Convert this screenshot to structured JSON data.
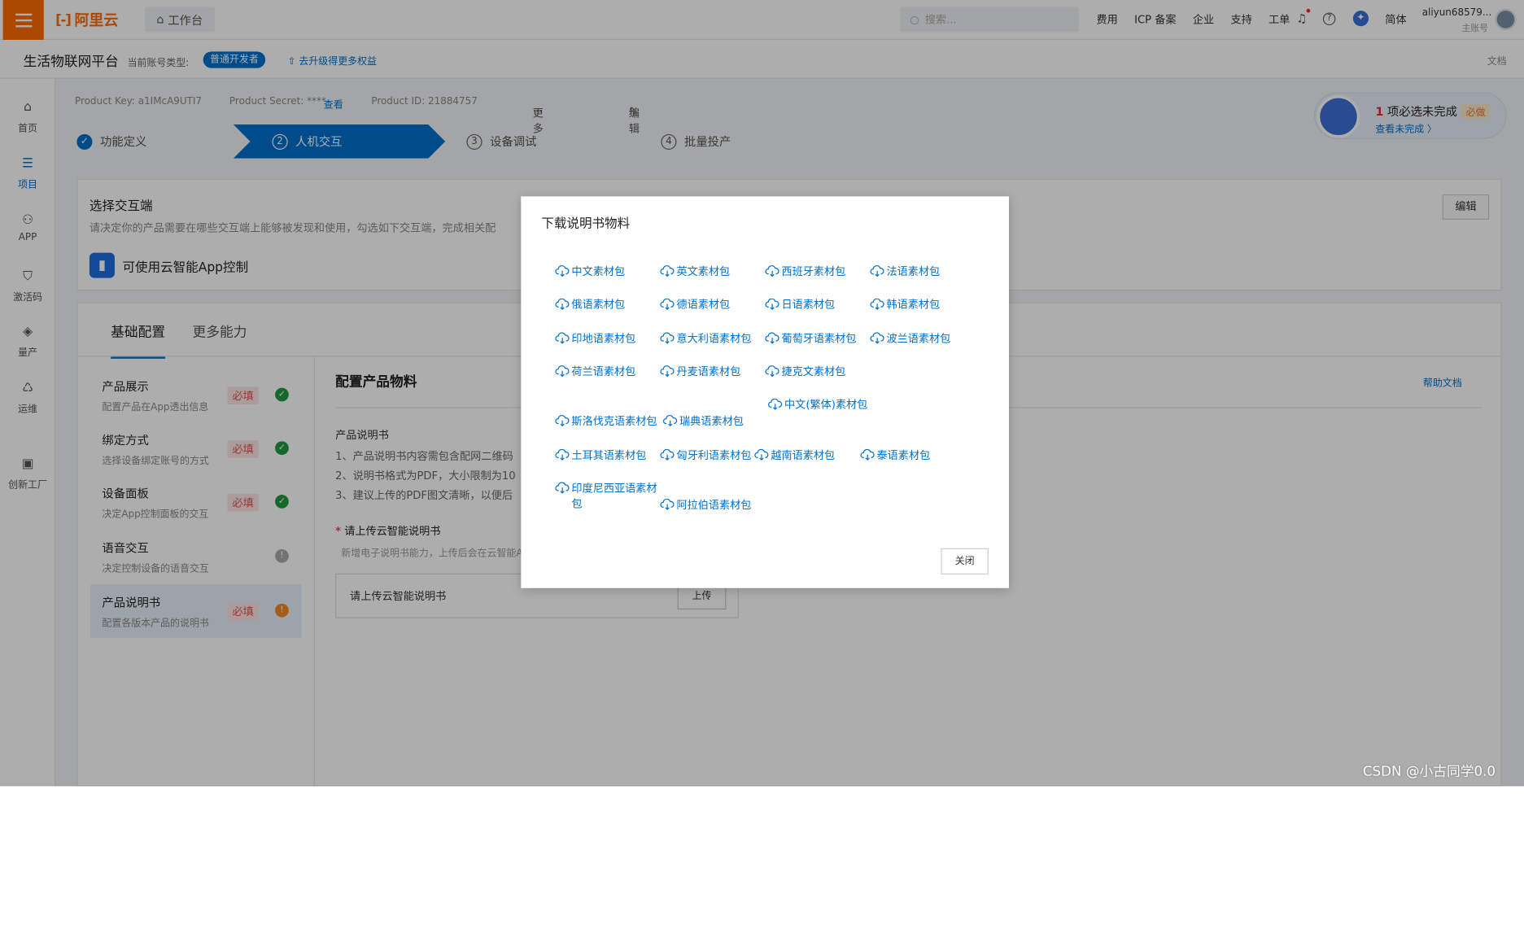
{
  "topbar": {
    "logo": "阿里云",
    "workbench": "工作台",
    "search_placeholder": "搜索...",
    "nav": [
      "费用",
      "ICP 备案",
      "企业",
      "支持",
      "工单"
    ],
    "lang": "简体",
    "username": "aliyun68579...",
    "user_role": "主账号",
    "accent": "#ff6a00"
  },
  "subbar": {
    "platform": "生活物联网平台",
    "account_type_label": "当前账号类型:",
    "account_badge": "普通开发者",
    "upgrade": "去升级得更多权益",
    "docs": "文档"
  },
  "sidebar": {
    "items": [
      {
        "label": "首页",
        "icon": "home-icon"
      },
      {
        "label": "项目",
        "icon": "list-icon"
      },
      {
        "label": "APP",
        "icon": "app-icon"
      },
      {
        "label": "激活码",
        "icon": "shield-icon"
      },
      {
        "label": "量产",
        "icon": "layers-icon"
      },
      {
        "label": "运维",
        "icon": "recycle-icon"
      },
      {
        "label": "创新工厂",
        "icon": "factory-icon"
      }
    ],
    "active_index": 1
  },
  "infobar": {
    "product_key": "Product Key:  a1IMcA9UTI7",
    "product_secret": "Product Secret: ****",
    "view": "查看",
    "product_id": "Product ID:  21884757",
    "more": "更多",
    "edit": "编辑"
  },
  "steps": [
    {
      "num": "✓",
      "label": "功能定义",
      "state": "done"
    },
    {
      "num": "2",
      "label": "人机交互",
      "state": "current"
    },
    {
      "num": "3",
      "label": "设备调试",
      "state": "todo"
    },
    {
      "num": "4",
      "label": "批量投产",
      "state": "todo"
    }
  ],
  "tip": {
    "count": "1",
    "text": " 项必选未完成",
    "required": "必做",
    "link": "查看未完成 〉"
  },
  "interaction": {
    "title": "选择交互端",
    "desc": "请决定你的产品需要在哪些交互端上能够被发现和使用，勾选如下交互端，完成相关配",
    "app": "可使用云智能App控制",
    "edit_button": "编辑"
  },
  "config": {
    "tabs": [
      "基础配置",
      "更多能力"
    ],
    "items": [
      {
        "name": "产品展示",
        "sub": "配置产品在App透出信息",
        "required": "必填",
        "status": "✓"
      },
      {
        "name": "绑定方式",
        "sub": "选择设备绑定账号的方式",
        "required": "必填",
        "status": "✓"
      },
      {
        "name": "设备面板",
        "sub": "决定App控制面板的交互",
        "required": "必填",
        "status": "✓"
      },
      {
        "name": "语音交互",
        "sub": "决定控制设备的语音交互",
        "required": "",
        "status": "!"
      },
      {
        "name": "产品说明书",
        "sub": "配置各版本产品的说明书",
        "required": "必填",
        "status": "!"
      }
    ],
    "right_title": "配置产品物料",
    "help": "帮助文档",
    "manual_title": "产品说明书",
    "manual_lines": [
      "1、产品说明书内容需包含配网二维码",
      "2、说明书格式为PDF，大小限制为10",
      "3、建议上传的PDF图文清晰，以便后"
    ],
    "upload_title_star": "*",
    "upload_title": " 请上传云智能说明书",
    "upload_desc": "新增电子说明书能力，上传后会在云智能A",
    "upload_label": "请上传云智能说明书",
    "upload_button": "上传"
  },
  "dialog": {
    "title": "下载说明书物料",
    "links": [
      "中文素材包",
      "英文素材包",
      "西班牙素材包",
      "法语素材包",
      "俄语素材包",
      "德语素材包",
      "日语素材包",
      "韩语素材包",
      "印地语素材包",
      "意大利语素材包",
      "葡萄牙语素材包",
      "波兰语素材包",
      "荷兰语素材包",
      "丹麦语素材包",
      "捷克文素材包",
      "斯洛伐克语素材包",
      "瑞典语素材包",
      "中文(繁体)素材包",
      "土耳其语素材包",
      "匈牙利语素材包",
      "越南语素材包",
      "泰语素材包",
      "印度尼西亚语素材包",
      "阿拉伯语素材包"
    ],
    "close": "关闭"
  },
  "watermark": "CSDN @小古同学0.0"
}
